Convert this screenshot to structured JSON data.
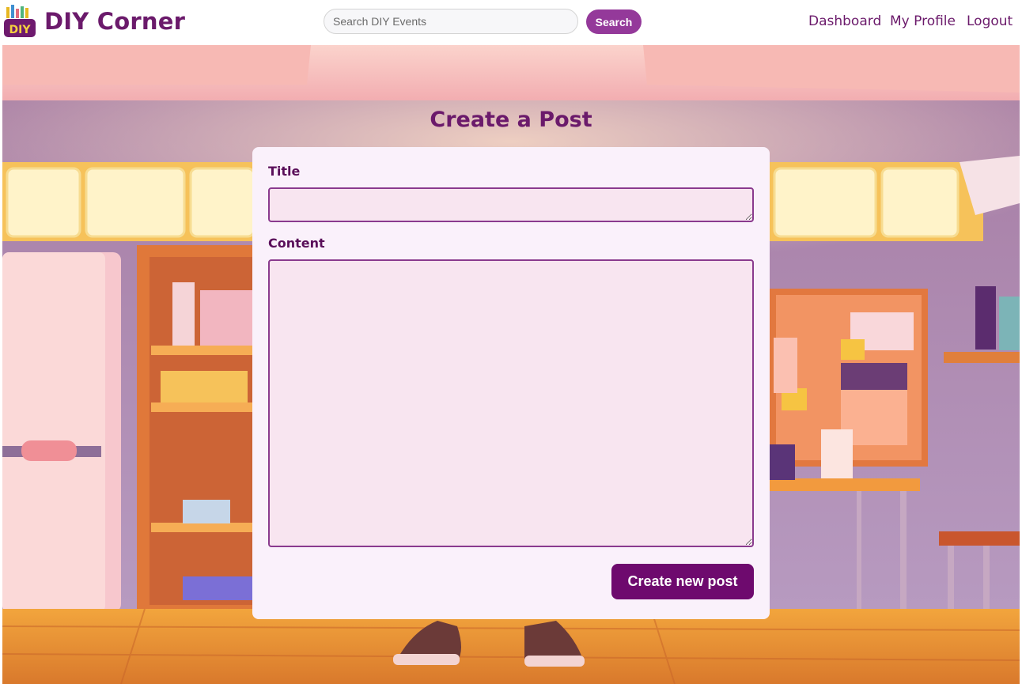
{
  "header": {
    "brand": "DIY Corner",
    "logo_text": "DIY",
    "search_placeholder": "Search DIY Events",
    "search_value": "",
    "search_button": "Search",
    "nav": {
      "dashboard": "Dashboard",
      "profile": "My Profile",
      "logout": "Logout"
    }
  },
  "main": {
    "title": "Create a Post",
    "form": {
      "title_label": "Title",
      "title_value": "",
      "content_label": "Content",
      "content_value": "",
      "submit": "Create new post"
    }
  },
  "colors": {
    "brand": "#6b1a6b",
    "search_button": "#94399a",
    "submit_button": "#6e0a6e",
    "card": "#faf1fb",
    "field": "#f8e5f0"
  },
  "icons": {
    "logo": "diy-logo-icon"
  }
}
